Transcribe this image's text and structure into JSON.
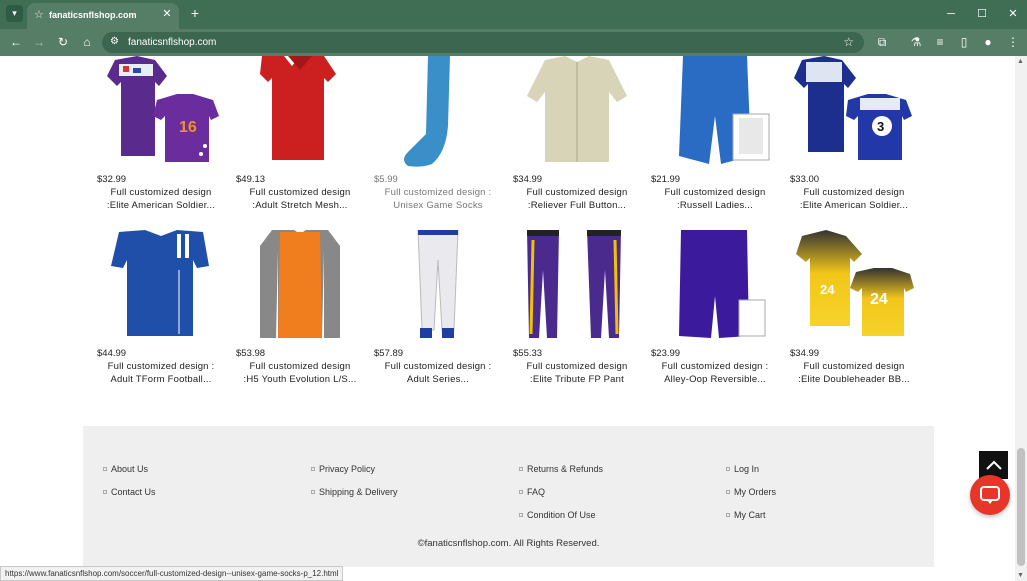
{
  "browser": {
    "tab_title": "fanaticsnflshop.com",
    "url": "fanaticsnflshop.com",
    "status_url": "https://www.fanaticsnflshop.com/soccer/full-customized-design--unisex-game-socks-p_12.html"
  },
  "products": [
    {
      "price": "$32.99",
      "line1": "Full customized design",
      "line2": ":Elite American Soldier..."
    },
    {
      "price": "$49.13",
      "line1": "Full customized design",
      "line2": ":Adult Stretch Mesh..."
    },
    {
      "price": "$5.99",
      "line1": "Full customized design :",
      "line2": "Unisex Game Socks"
    },
    {
      "price": "$34.99",
      "line1": "Full customized design",
      "line2": ":Reliever Full Button..."
    },
    {
      "price": "$21.99",
      "line1": "Full customized design",
      "line2": ":Russell Ladies..."
    },
    {
      "price": "$33.00",
      "line1": "Full customized design",
      "line2": ":Elite American Soldier..."
    },
    {
      "price": "$44.99",
      "line1": "Full customized design :",
      "line2": "Adult TForm Football..."
    },
    {
      "price": "$53.98",
      "line1": "Full customized design",
      "line2": ":H5 Youth Evolution L/S..."
    },
    {
      "price": "$57.89",
      "line1": "Full customized design :",
      "line2": "Adult Series..."
    },
    {
      "price": "$55.33",
      "line1": "Full customized design",
      "line2": ":Elite Tribute FP Pant"
    },
    {
      "price": "$23.99",
      "line1": "Full customized design :",
      "line2": "Alley-Oop Reversible..."
    },
    {
      "price": "$34.99",
      "line1": "Full customized design",
      "line2": ":Elite Doubleheader BB..."
    }
  ],
  "footer": {
    "col1": [
      "About Us",
      "Contact Us"
    ],
    "col2": [
      "Privacy Policy",
      "Shipping & Delivery"
    ],
    "col3": [
      "Returns & Refunds",
      "FAQ",
      "Condition Of Use"
    ],
    "col4": [
      "Log In",
      "My Orders",
      "My Cart"
    ],
    "copyright": "©fanaticsnflshop.com. All Rights Reserved."
  }
}
